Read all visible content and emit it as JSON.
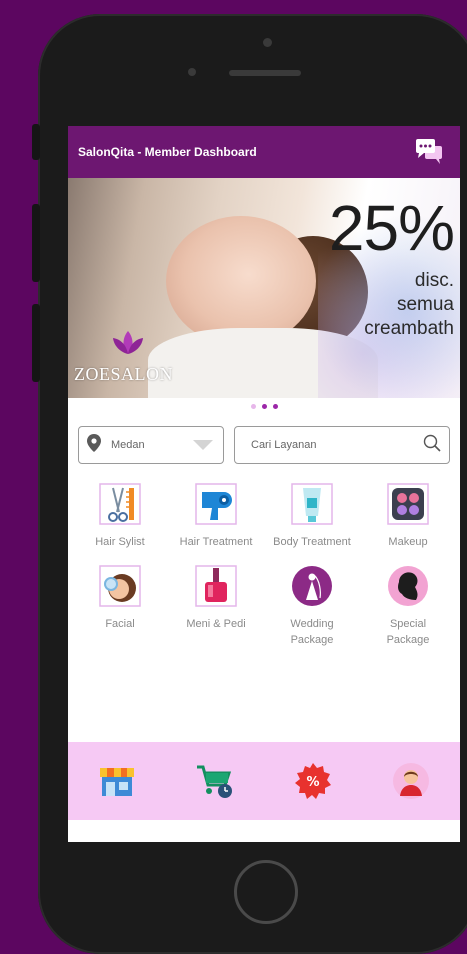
{
  "app": {
    "title": "SalonQita - Member Dashboard",
    "chat_icon": "chat-bubbles-icon"
  },
  "banner": {
    "discount": "25%",
    "lines": [
      "disc.",
      "semua",
      "creambath"
    ],
    "brand": "ZOESALON"
  },
  "carousel": {
    "count": 3,
    "active": 2
  },
  "location": {
    "value": "Medan",
    "icon": "location-pin-icon"
  },
  "search": {
    "placeholder": "Cari Layanan",
    "icon": "search-icon"
  },
  "categories": [
    {
      "label": "Hair Sylist",
      "icon": "scissors-comb-icon"
    },
    {
      "label": "Hair Treatment",
      "icon": "hair-dryer-icon"
    },
    {
      "label": "Body Treatment",
      "icon": "lotion-tube-icon"
    },
    {
      "label": "Makeup",
      "icon": "makeup-palette-icon"
    },
    {
      "label": "Facial",
      "icon": "facial-icon"
    },
    {
      "label": "Meni & Pedi",
      "icon": "nail-polish-icon"
    },
    {
      "label": "Wedding Package",
      "icon": "bride-icon"
    },
    {
      "label": "Special Package",
      "icon": "woman-silhouette-icon"
    }
  ],
  "bottom_nav": [
    {
      "name": "store",
      "icon": "store-icon"
    },
    {
      "name": "cart",
      "icon": "cart-clock-icon"
    },
    {
      "name": "promo",
      "icon": "discount-badge-icon"
    },
    {
      "name": "profile",
      "icon": "user-avatar-icon"
    }
  ],
  "colors": {
    "brand": "#6d1771",
    "background": "#5c0660",
    "nav_bar": "#f6c9f4",
    "accent": "#9c27a8"
  }
}
